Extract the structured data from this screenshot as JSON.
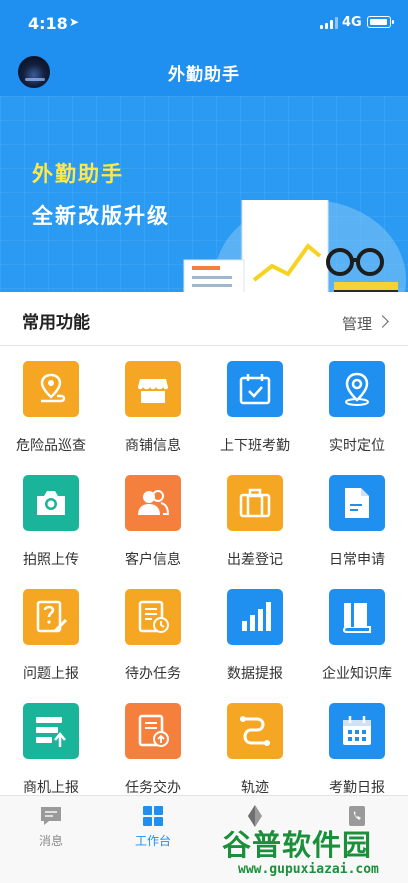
{
  "status": {
    "time": "4:18",
    "network": "4G"
  },
  "header": {
    "title": "外勤助手"
  },
  "banner": {
    "line1": "外勤助手",
    "line2": "全新改版升级"
  },
  "section": {
    "title": "常用功能",
    "manage": "管理"
  },
  "functions": [
    {
      "label": "危险品巡查",
      "icon": "location-route-icon",
      "color": "#f5a623"
    },
    {
      "label": "商铺信息",
      "icon": "shop-icon",
      "color": "#f5a623"
    },
    {
      "label": "上下班考勤",
      "icon": "calendar-check-icon",
      "color": "#1f8ff0"
    },
    {
      "label": "实时定位",
      "icon": "location-pin-icon",
      "color": "#1f8ff0"
    },
    {
      "label": "拍照上传",
      "icon": "camera-icon",
      "color": "#1ab49b"
    },
    {
      "label": "客户信息",
      "icon": "contacts-icon",
      "color": "#f5803e"
    },
    {
      "label": "出差登记",
      "icon": "suitcase-icon",
      "color": "#f5a623"
    },
    {
      "label": "日常申请",
      "icon": "document-icon",
      "color": "#1f8ff0"
    },
    {
      "label": "问题上报",
      "icon": "question-edit-icon",
      "color": "#f5a623"
    },
    {
      "label": "待办任务",
      "icon": "task-clock-icon",
      "color": "#f5a623"
    },
    {
      "label": "数据提报",
      "icon": "bar-chart-icon",
      "color": "#1f8ff0"
    },
    {
      "label": "企业知识库",
      "icon": "book-icon",
      "color": "#1f8ff0"
    },
    {
      "label": "商机上报",
      "icon": "list-upload-icon",
      "color": "#1ab49b"
    },
    {
      "label": "任务交办",
      "icon": "task-upload-icon",
      "color": "#f5803e"
    },
    {
      "label": "轨迹",
      "icon": "track-icon",
      "color": "#f5a623"
    },
    {
      "label": "考勤日报",
      "icon": "calendar-grid-icon",
      "color": "#1f8ff0"
    }
  ],
  "tabs": [
    {
      "label": "消息",
      "icon": "message-icon"
    },
    {
      "label": "工作台",
      "icon": "grid-icon",
      "active": true
    },
    {
      "label": "",
      "icon": "compass-icon"
    },
    {
      "label": "",
      "icon": "contacts-book-icon"
    }
  ],
  "watermark": {
    "main": "谷普软件园",
    "sub": "www.gupuxiazai.com"
  },
  "colors": {
    "primary": "#1f8ff0",
    "orange": "#f5a623",
    "teal": "#1ab49b",
    "coral": "#f5803e"
  }
}
